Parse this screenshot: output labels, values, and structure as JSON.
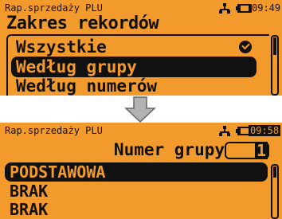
{
  "screen1": {
    "header": "Rap.sprzedaży PLU",
    "clock": "09:49",
    "title": "Zakres rekordów",
    "items": [
      {
        "label": "Wszystkie",
        "checked": true
      },
      {
        "label": "Według grupy",
        "selected": true
      },
      {
        "label": "Według numerów"
      }
    ]
  },
  "screen2": {
    "header": "Rap.sprzedaży PLU",
    "clock": "09:58",
    "field_label": "Numer grupy",
    "field_value": "1",
    "rows": [
      {
        "label": "PODSTAWOWA",
        "selected": true
      },
      {
        "label": "BRAK"
      },
      {
        "label": "BRAK"
      }
    ]
  },
  "colors": {
    "lcd_background": "#f39a2c",
    "foreground": "#111111"
  },
  "icons": [
    "network-icon",
    "battery-icon",
    "checkmark-icon",
    "arrow-down-icon"
  ]
}
